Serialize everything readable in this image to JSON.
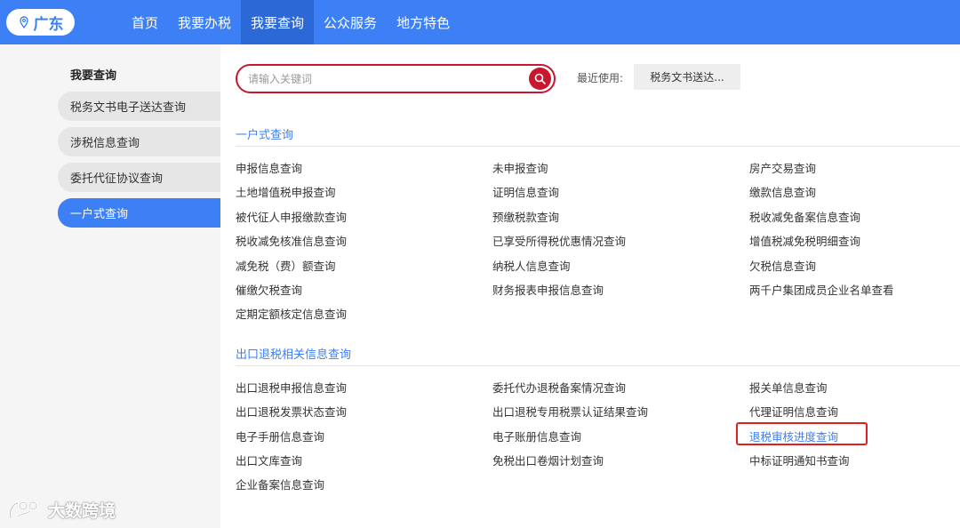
{
  "header": {
    "region": "广东",
    "nav": [
      "首页",
      "我要办税",
      "我要查询",
      "公众服务",
      "地方特色"
    ]
  },
  "sidebar": {
    "title": "我要查询",
    "items": [
      "税务文书电子送达查询",
      "涉税信息查询",
      "委托代征协议查询",
      "一户式查询"
    ]
  },
  "search": {
    "placeholder": "请输入关键词",
    "recent_label": "最近使用:",
    "recent_item": "税务文书送达..."
  },
  "sections": [
    {
      "title": "一户式查询",
      "links": [
        "申报信息查询",
        "未申报查询",
        "房产交易查询",
        "土地增值税申报查询",
        "证明信息查询",
        "缴款信息查询",
        "被代征人申报缴款查询",
        "预缴税款查询",
        "税收减免备案信息查询",
        "税收减免核准信息查询",
        "已享受所得税优惠情况查询",
        "增值税减免税明细查询",
        "减免税（费）额查询",
        "纳税人信息查询",
        "欠税信息查询",
        "催缴欠税查询",
        "财务报表申报信息查询",
        "两千户集团成员企业名单查看",
        "定期定额核定信息查询"
      ]
    },
    {
      "title": "出口退税相关信息查询",
      "links": [
        "出口退税申报信息查询",
        "委托代办退税备案情况查询",
        "报关单信息查询",
        "出口退税发票状态查询",
        "出口退税专用税票认证结果查询",
        "代理证明信息查询",
        "电子手册信息查询",
        "电子账册信息查询",
        "退税审核进度查询",
        "出口文库查询",
        "免税出口卷烟计划查询",
        "中标证明通知书查询",
        "企业备案信息查询"
      ]
    }
  ],
  "watermark": "大数跨境",
  "colors": {
    "brand": "#3d7ff5",
    "search_border": "#c8162f",
    "highlight_box": "#e02020"
  }
}
